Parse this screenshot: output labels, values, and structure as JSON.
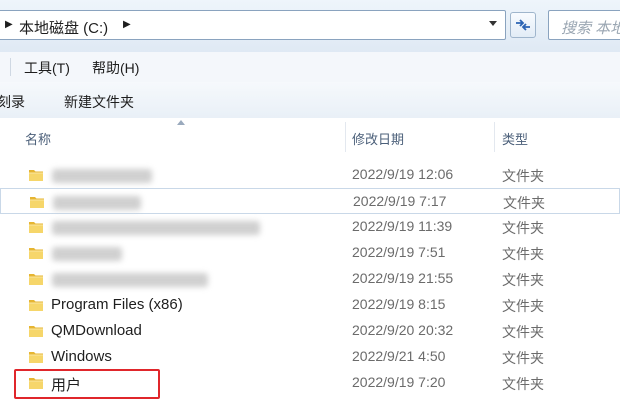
{
  "address_bar": {
    "path": "本地磁盘 (C:)",
    "search_placeholder": "搜索 本地"
  },
  "menu": {
    "items": [
      "工具(T)",
      "帮助(H)"
    ]
  },
  "toolbar": {
    "items": [
      "刻录",
      "新建文件夹"
    ]
  },
  "columns": {
    "name": "名称",
    "date": "修改日期",
    "type": "类型"
  },
  "files": [
    {
      "name": "",
      "date": "2022/9/19 12:06",
      "type": "文件夹",
      "blurred": true
    },
    {
      "name": "",
      "date": "2022/9/19 7:17",
      "type": "文件夹",
      "blurred": true
    },
    {
      "name": "",
      "date": "2022/9/19 11:39",
      "type": "文件夹",
      "blurred": true
    },
    {
      "name": "",
      "date": "2022/9/19 7:51",
      "type": "文件夹",
      "blurred": true
    },
    {
      "name": "",
      "date": "2022/9/19 21:55",
      "type": "文件夹",
      "blurred": true
    },
    {
      "name": "Program Files (x86)",
      "date": "2022/9/19 8:15",
      "type": "文件夹"
    },
    {
      "name": "QMDownload",
      "date": "2022/9/20 20:32",
      "type": "文件夹"
    },
    {
      "name": "Windows",
      "date": "2022/9/21 4:50",
      "type": "文件夹"
    },
    {
      "name": "用户",
      "date": "2022/9/19 7:20",
      "type": "文件夹",
      "highlighted": true
    }
  ],
  "colors": {
    "highlight_box": "#e0262b",
    "folder_yellow": "#f3c64b"
  }
}
